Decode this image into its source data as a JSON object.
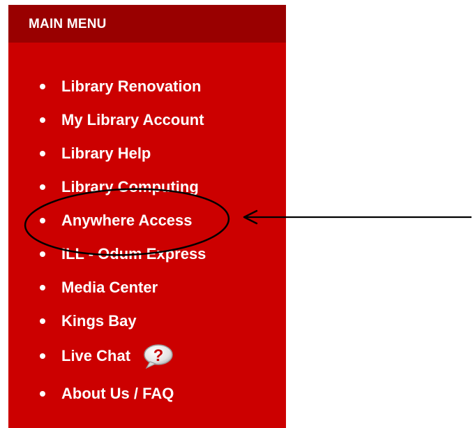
{
  "menu": {
    "title": "MAIN MENU",
    "items": [
      {
        "label": "Library Renovation"
      },
      {
        "label": "My Library Account"
      },
      {
        "label": "Library Help"
      },
      {
        "label": "Library Computing"
      },
      {
        "label": "Anywhere Access"
      },
      {
        "label": "ILL - Odum Express"
      },
      {
        "label": "Media Center"
      },
      {
        "label": "Kings Bay"
      },
      {
        "label": "Live Chat",
        "icon": "question-bubble-icon"
      },
      {
        "label": "About Us / FAQ"
      }
    ]
  },
  "annotation": {
    "highlighted_item": "Anywhere Access",
    "shapes": [
      "ellipse-outline",
      "arrow-left"
    ]
  },
  "colors": {
    "panel": "#cc0000",
    "header": "#990000",
    "text": "#ffffff",
    "annotation": "#000000"
  }
}
